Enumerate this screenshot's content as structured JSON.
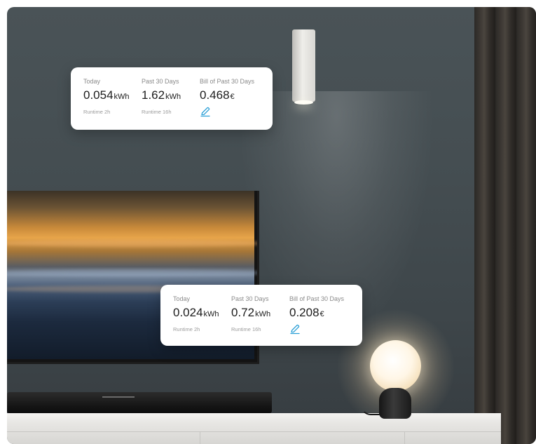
{
  "cards": {
    "top": {
      "today_label": "Today",
      "today_value": "0.054",
      "today_unit": "kWh",
      "today_runtime": "Runtime 2h",
      "past_label": "Past 30 Days",
      "past_value": "1.62",
      "past_unit": "kWh",
      "past_runtime": "Runtime 16h",
      "bill_label": "Bill of Past 30 Days",
      "bill_value": "0.468",
      "bill_unit": "€",
      "edit_icon": "edit-pencil-icon"
    },
    "bottom": {
      "today_label": "Today",
      "today_value": "0.024",
      "today_unit": "kWh",
      "today_runtime": "Runtime 2h",
      "past_label": "Past 30 Days",
      "past_value": "0.72",
      "past_unit": "kWh",
      "past_runtime": "Runtime 16h",
      "bill_label": "Bill of Past 30 Days",
      "bill_value": "0.208",
      "bill_unit": "€",
      "edit_icon": "edit-pencil-icon"
    }
  },
  "colors": {
    "accent": "#2a9fd6",
    "card_background": "#ffffff",
    "wall": "#454e52"
  }
}
